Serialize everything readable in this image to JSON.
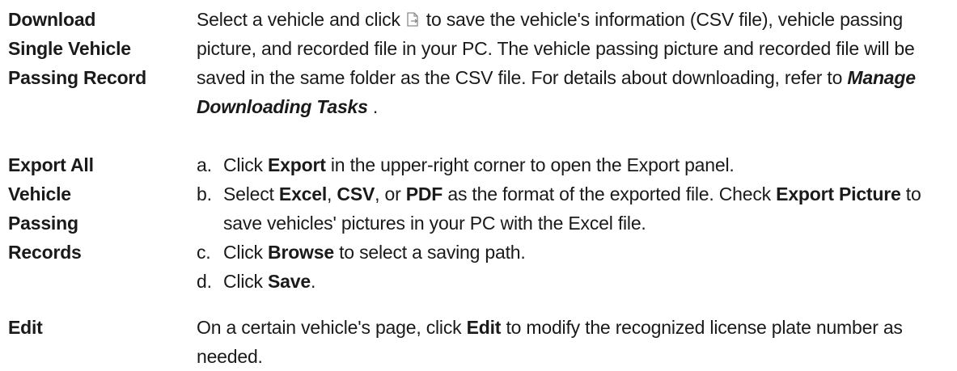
{
  "rows": [
    {
      "term_lines": [
        "Download",
        "Single Vehicle",
        "Passing Record"
      ],
      "desc": {
        "part1": "Select a vehicle and click",
        "icon": "download-file-icon",
        "part2": "to save the vehicle's information (CSV file), vehicle passing picture, and recorded file in your PC. The vehicle passing picture and recorded file will be saved in the same folder as the CSV file. For details about downloading, refer to",
        "link": "Manage Downloading Tasks",
        "end": " ."
      }
    },
    {
      "term_lines": [
        "Export All",
        "Vehicle",
        "Passing",
        "Records"
      ],
      "steps": [
        {
          "marker": "a.",
          "t1": "Click ",
          "b1": "Export",
          "t2": " in the upper-right corner to open the Export panel."
        },
        {
          "marker": "b.",
          "t1": "Select ",
          "b1": "Excel",
          "t2": ", ",
          "b2": "CSV",
          "t3": ", or ",
          "b3": "PDF",
          "t4": " as the format of the exported file. Check ",
          "b4": "Export Picture",
          "t5": " to save vehicles' pictures in your PC with the Excel file."
        },
        {
          "marker": "c.",
          "t1": "Click ",
          "b1": "Browse",
          "t2": " to select a saving path."
        },
        {
          "marker": "d.",
          "t1": "Click ",
          "b1": "Save",
          "t2": "."
        }
      ]
    },
    {
      "term_lines": [
        "Edit"
      ],
      "desc": {
        "part1": "On a certain vehicle's page, click ",
        "bold": "Edit",
        "part2": " to modify the recognized license plate number as needed."
      }
    }
  ]
}
